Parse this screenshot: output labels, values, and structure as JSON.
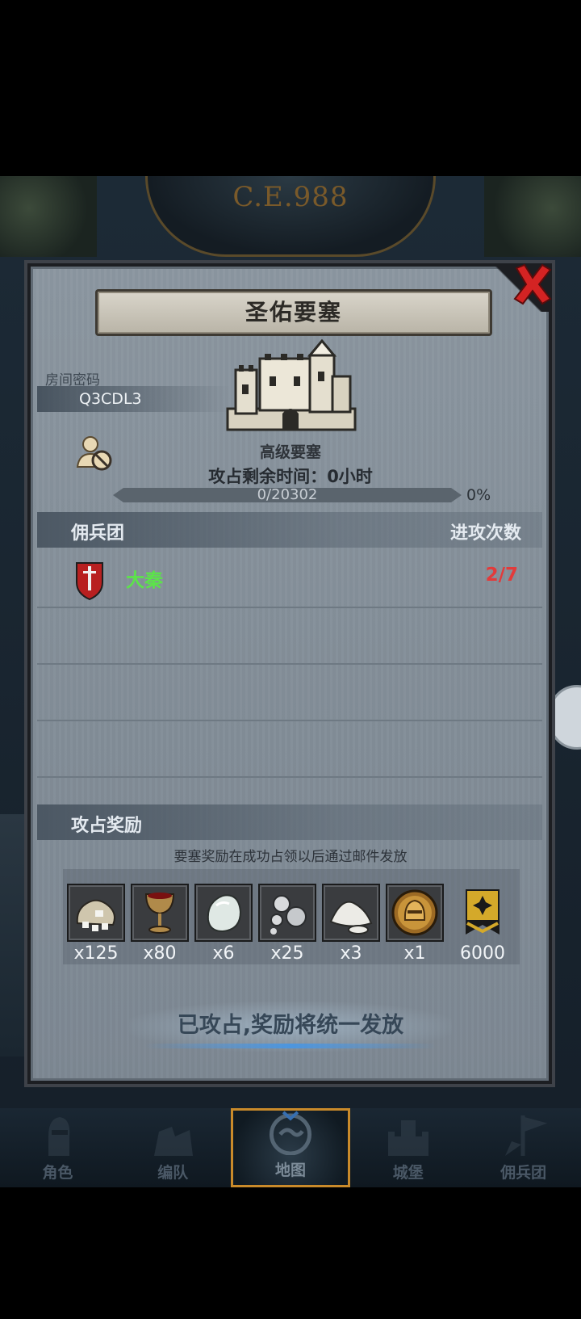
{
  "header": {
    "year": "C.E.988"
  },
  "dialog": {
    "title": "圣佑要塞",
    "room_code_label": "房间密码",
    "room_code": "Q3CDL3",
    "fortress_type": "高级要塞",
    "time_label": "攻占剩余时间：",
    "time_value": "0小时",
    "progress_text": "0/20302",
    "progress_percent": "0%",
    "progress_fraction": 0.0,
    "mercenary_header": "佣兵团",
    "attack_count_header": "进攻次数",
    "mercenaries": [
      {
        "name": "大秦",
        "attacks": "2/7"
      }
    ],
    "rewards_header": "攻占奖励",
    "rewards_note": "要塞奖励在成功占领以后通过邮件发放",
    "rewards": [
      {
        "icon": "salt-bag-icon",
        "qty": "x125"
      },
      {
        "icon": "goblet-icon",
        "qty": "x80"
      },
      {
        "icon": "white-gem-icon",
        "qty": "x6"
      },
      {
        "icon": "silver-pearls-icon",
        "qty": "x25"
      },
      {
        "icon": "white-powder-icon",
        "qty": "x3"
      },
      {
        "icon": "golden-helmet-icon",
        "qty": "x1"
      },
      {
        "icon": "rank-banner-icon",
        "qty": "6000"
      }
    ],
    "claim_button": "已攻占,奖励将统一发放"
  },
  "nav": [
    {
      "label": "角色",
      "icon": "knight-icon"
    },
    {
      "label": "编队",
      "icon": "squad-icon"
    },
    {
      "label": "地图",
      "icon": "map-icon"
    },
    {
      "label": "城堡",
      "icon": "castle-icon"
    },
    {
      "label": "佣兵团",
      "icon": "mercenary-icon"
    }
  ],
  "colors": {
    "panel": "#848f99",
    "ally_name": "#5ce34a",
    "attack_count": "#e23b3b",
    "close_red": "#d42323",
    "active_nav_border": "#c98a2a"
  }
}
